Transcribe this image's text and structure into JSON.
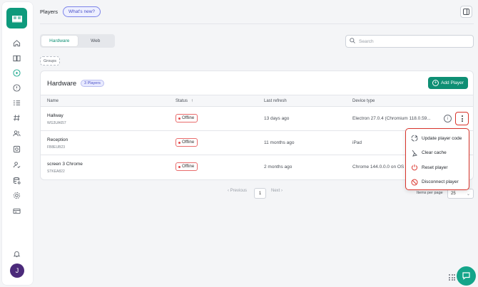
{
  "header": {
    "title": "Players",
    "whats_new": "What's new?"
  },
  "sidebar": {
    "logo": "book-logo-icon",
    "items": [
      {
        "icon": "home-icon"
      },
      {
        "icon": "book-icon"
      },
      {
        "icon": "play-icon"
      },
      {
        "icon": "alert-icon"
      },
      {
        "icon": "list-icon"
      },
      {
        "icon": "hash-icon"
      },
      {
        "icon": "users-icon"
      },
      {
        "icon": "media-icon"
      },
      {
        "icon": "user-check-icon"
      },
      {
        "icon": "database-icon"
      },
      {
        "icon": "gear-icon"
      },
      {
        "icon": "card-icon"
      }
    ],
    "bell": "bell-icon",
    "avatar_initial": "J"
  },
  "tabs": {
    "hardware": "Hardware",
    "web": "Web",
    "active": "Hardware"
  },
  "search": {
    "placeholder": "Search",
    "value": ""
  },
  "groups_label": "Groups",
  "card": {
    "title": "Hardware",
    "count": "3 Players",
    "add_button": "Add Player"
  },
  "table": {
    "columns": {
      "name": "Name",
      "status": "Status",
      "last_refresh": "Last refresh",
      "device_type": "Device type"
    },
    "rows": [
      {
        "name": "Hallway",
        "id": "WG3UA657",
        "status": "Offline",
        "last_refresh": "13 days ago",
        "device_type": "Electron 27.0.4 (Chromium 118.0.59..."
      },
      {
        "name": "Reception",
        "id": "FB8EUB23",
        "status": "Offline",
        "last_refresh": "11 months ago",
        "device_type": "iPad"
      },
      {
        "name": "screen 3 Chrome",
        "id": "STKEA822",
        "status": "Offline",
        "last_refresh": "2 months ago",
        "device_type": "Chrome 144.0.0.0 on OS"
      }
    ]
  },
  "menu": {
    "items": [
      {
        "label": "Update player code",
        "icon": "sync-icon"
      },
      {
        "label": "Clear cache",
        "icon": "broom-icon"
      },
      {
        "label": "Reset player",
        "icon": "power-icon"
      },
      {
        "label": "Disconnect player",
        "icon": "unlink-icon"
      }
    ]
  },
  "pagination": {
    "previous": "Previous",
    "next": "Next",
    "page": "1",
    "items_per_page_label": "Items per page",
    "items_per_page": "25"
  },
  "colors": {
    "accent": "#0e8f74",
    "danger": "#d9342b",
    "badge": "#4a50c7"
  }
}
